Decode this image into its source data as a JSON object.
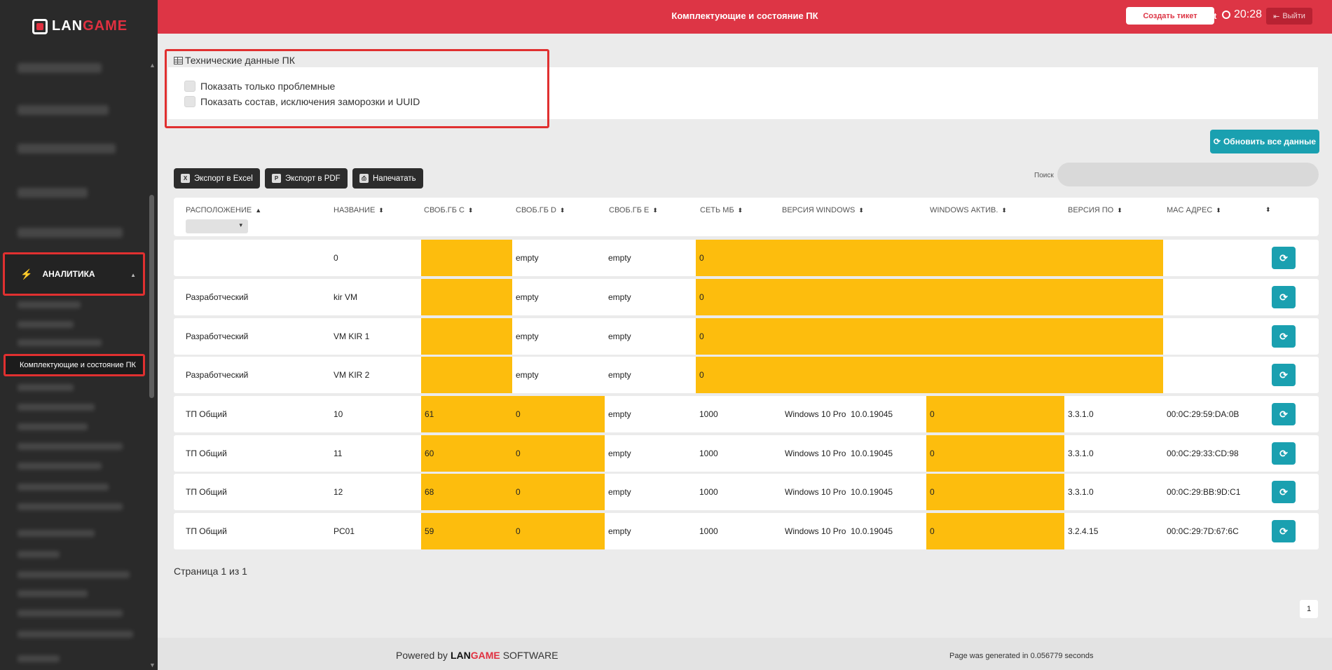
{
  "brand": {
    "logo_lan": "LAN",
    "logo_game": "GAME",
    "colors": {
      "primary_red": "#dd3545",
      "accent_teal": "#1aa0b0",
      "warning_yellow": "#fdbd0d"
    }
  },
  "header": {
    "title": "Комплектующие и состояние ПК",
    "create_ticket": "Создать тикет",
    "user": "Root",
    "time": "20:28",
    "logout": "Выйти"
  },
  "sidebar": {
    "analytics_label": "АНАЛИТИКА",
    "active_sub_label": "Комплектующие и состояние ПК"
  },
  "panel": {
    "title": "Технические данные ПК",
    "checkbox_problems": "Показать только проблемные",
    "checkbox_composition": "Показать состав, исключения заморозки и UUID"
  },
  "toolbar": {
    "refresh_all": "Обновить все данные",
    "export_excel": "Экспорт в Excel",
    "export_pdf": "Экспорт в PDF",
    "print": "Напечатать",
    "search_label": "Поиск"
  },
  "table": {
    "columns": [
      "РАСПОЛОЖЕНИЕ",
      "НАЗВАНИЕ",
      "СВОБ.ГБ C",
      "СВОБ.ГБ D",
      "СВОБ.ГБ E",
      "СЕТЬ МБ",
      "ВЕРСИЯ WINDOWS",
      "WINDOWS АКТИВ.",
      "ВЕРСИЯ ПО",
      "MAC АДРЕС",
      ""
    ],
    "rows": [
      {
        "location": "",
        "name": "0",
        "c": "",
        "d": "empty",
        "e": "empty",
        "net": "0",
        "win": "",
        "act": "",
        "ver": "",
        "mac": ""
      },
      {
        "location": "Разработческий",
        "name": "kir VM",
        "c": "",
        "d": "empty",
        "e": "empty",
        "net": "0",
        "win": "",
        "act": "",
        "ver": "",
        "mac": ""
      },
      {
        "location": "Разработческий",
        "name": "VM KIR 1",
        "c": "",
        "d": "empty",
        "e": "empty",
        "net": "0",
        "win": "",
        "act": "",
        "ver": "",
        "mac": ""
      },
      {
        "location": "Разработческий",
        "name": "VM KIR 2",
        "c": "",
        "d": "empty",
        "e": "empty",
        "net": "0",
        "win": "",
        "act": "",
        "ver": "",
        "mac": ""
      },
      {
        "location": "ТП Общий",
        "name": "10",
        "c": "61",
        "d": "0",
        "e": "empty",
        "net": "1000",
        "win": "Windows 10 Pro  10.0.19045",
        "act": "0",
        "ver": "3.3.1.0",
        "mac": "00:0C:29:59:DA:0B"
      },
      {
        "location": "ТП Общий",
        "name": "11",
        "c": "60",
        "d": "0",
        "e": "empty",
        "net": "1000",
        "win": "Windows 10 Pro  10.0.19045",
        "act": "0",
        "ver": "3.3.1.0",
        "mac": "00:0C:29:33:CD:98"
      },
      {
        "location": "ТП Общий",
        "name": "12",
        "c": "68",
        "d": "0",
        "e": "empty",
        "net": "1000",
        "win": "Windows 10 Pro  10.0.19045",
        "act": "0",
        "ver": "3.3.1.0",
        "mac": "00:0C:29:BB:9D:C1"
      },
      {
        "location": "ТП Общий",
        "name": "PC01",
        "c": "59",
        "d": "0",
        "e": "empty",
        "net": "1000",
        "win": "Windows 10 Pro  10.0.19045",
        "act": "0",
        "ver": "3.2.4.15",
        "mac": "00:0C:29:7D:67:6C"
      }
    ]
  },
  "pager": {
    "text": "Страница 1 из 1",
    "current": "1"
  },
  "footer": {
    "powered_by": "Powered by",
    "brand_lan": "LAN",
    "brand_game": "GAME",
    "software": "SOFTWARE",
    "generated": "Page was generated in 0.056779 seconds"
  }
}
